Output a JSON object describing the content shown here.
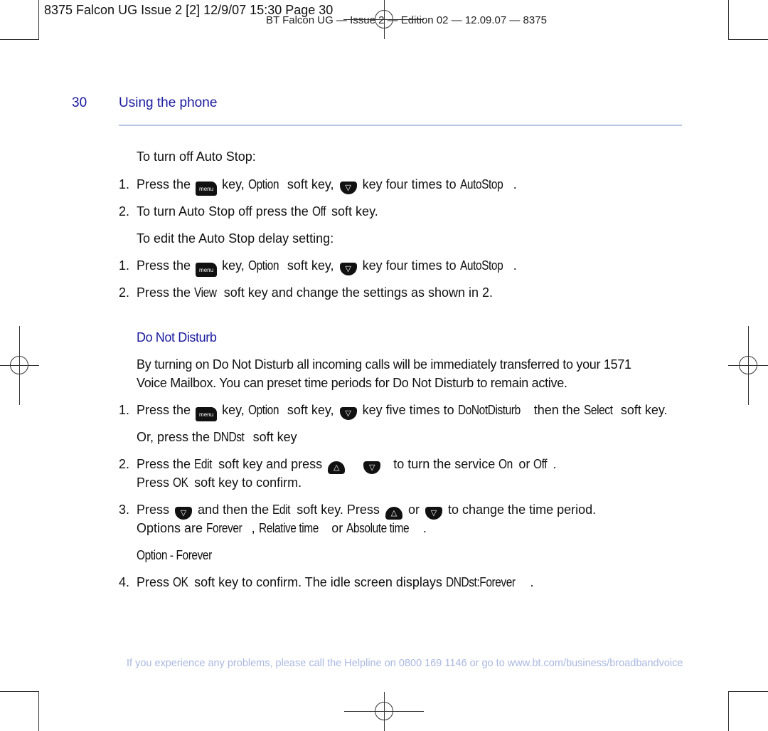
{
  "print_slug": "8375 Falcon UG Issue 2 [2]  12/9/07  15:30  Page 30",
  "running_header": "BT Falcon UG — Issue 2 — Edition 02 — 12.09.07 — 8375",
  "page_number": "30",
  "section_title": "Using the phone",
  "colors": {
    "heading": "#1a1aa0",
    "rule": "#b9c7e6",
    "footer": "#a9b8e0"
  },
  "icons": {
    "menu_key": "menu",
    "nav_down": "▽",
    "nav_up": "△"
  },
  "auto_stop_off": {
    "intro": "To turn off Auto Stop:",
    "step1": {
      "num": "1.",
      "a": "Press the",
      "b": "key,",
      "c": "Option",
      "d": "soft key,",
      "e": "key four times to",
      "f": "AutoStop",
      "g": "."
    },
    "step2": {
      "num": "2.",
      "a": "To turn Auto Stop off press the",
      "b": "Off",
      "c": "soft key."
    }
  },
  "auto_stop_edit": {
    "intro": "To edit the Auto Stop delay setting:",
    "step1": {
      "num": "1.",
      "a": "Press the",
      "b": "key,",
      "c": "Option",
      "d": "soft key,",
      "e": "key four times to",
      "f": "AutoStop",
      "g": "."
    },
    "step2": {
      "num": "2.",
      "a": "Press the",
      "b": "View",
      "c": "soft key and change the settings as shown in 2."
    }
  },
  "dnd": {
    "heading": "Do Not Disturb",
    "para_line1": "By turning on Do Not Disturb all incoming calls will be immediately transferred to your 1571",
    "para_line2": "Voice Mailbox. You can preset time periods for Do Not Disturb to remain active.",
    "step1": {
      "num": "1.",
      "a": "Press the",
      "b": "key,",
      "c": "Option",
      "d": "soft key,",
      "e": "key five times to",
      "f": "DoNotDisturb",
      "g": "then the",
      "h": "Select",
      "i": "soft key."
    },
    "or_line": {
      "a": "Or, press the",
      "b": "DNDst",
      "c": "soft key"
    },
    "step2": {
      "num": "2.",
      "a": "Press the",
      "b": "Edit",
      "c": "soft key and press",
      "d": "to turn the service",
      "e": "On",
      "f": "or",
      "g": "Off",
      "h": "."
    },
    "step2b": {
      "a": "Press",
      "b": "OK",
      "c": "soft key to confirm."
    },
    "step3": {
      "num": "3.",
      "a": "Press",
      "b": "and then the",
      "c": "Edit",
      "d": "soft key. Press",
      "e": "or",
      "f": "to change the time period."
    },
    "step3b": {
      "a": "Options are",
      "b": "Forever",
      "c": ",",
      "d": "Relative time",
      "e": "or",
      "f": "Absolute time",
      "g": "."
    },
    "option_line": "Option - Forever",
    "step4": {
      "num": "4.",
      "a": "Press",
      "b": "OK",
      "c": "soft key to confirm. The idle screen displays",
      "d": "DNDst:Forever",
      "e": "."
    }
  },
  "footer": {
    "a": "If you experience any problems, please call the Helpline on",
    "phone": "0800 169 1146",
    "b": "or go to",
    "url": "www.bt.com/business/broadbandvoice"
  }
}
